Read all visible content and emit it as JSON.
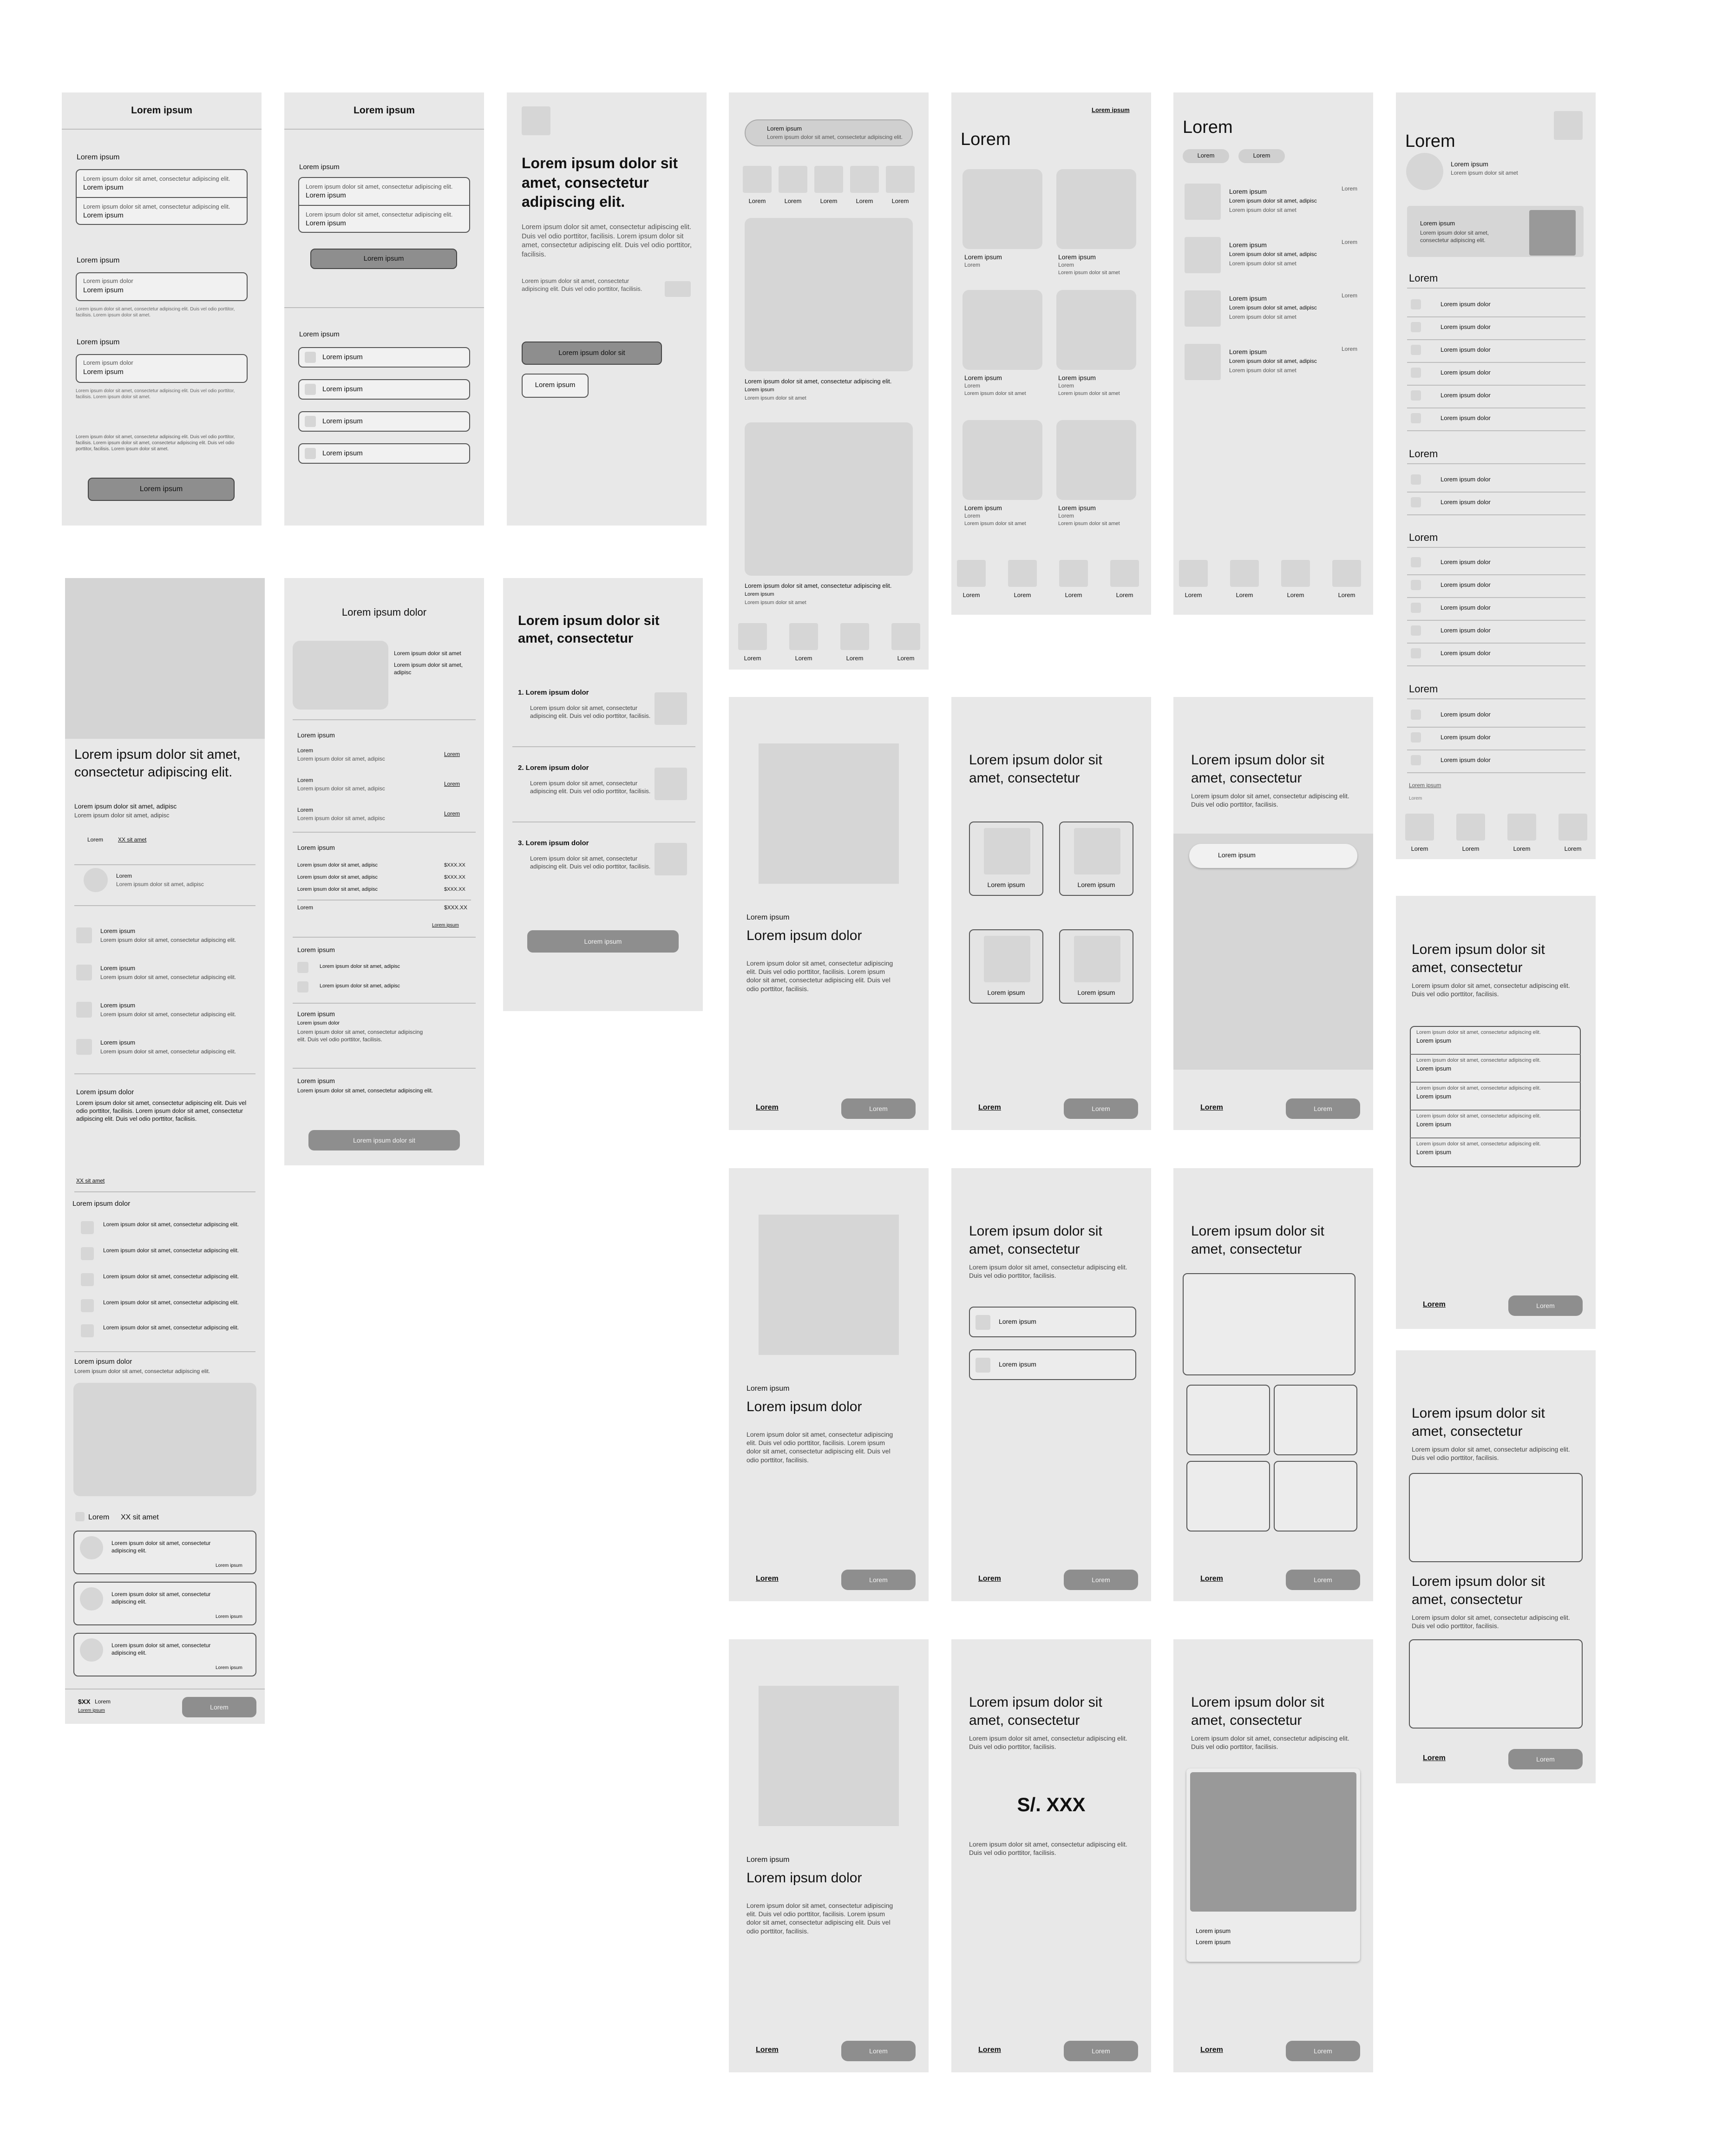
{
  "L": {
    "lorem": "Lorem",
    "lorem_ipsum": "Lorem ipsum",
    "lorem_ipsum_dolor": "Lorem ipsum dolor",
    "lorem_ipsum_dolor_sit": "Lorem ipsum dolor sit",
    "heading2": "Lorem ipsum dolor sit amet, consectetur",
    "heading3": "Lorem ipsum dolor sit amet, consectetur adipiscing elit.",
    "field_hint": "Lorem ipsum dolor sit amet, consectetur adipiscing elit.",
    "body2": "Lorem ipsum dolor sit amet, consectetur adipiscing elit. Duis vel odio porttitor, facilisis.",
    "body_long": "Lorem ipsum dolor sit amet, consectetur adipiscing elit. Duis vel odio porttitor, facilisis. Lorem ipsum dolor sit amet, consectetur adipiscing elit. Duis vel odio porttitor, facilisis.",
    "small_text": "Lorem ipsum dolor sit amet, consectetur adipiscing elit. Duis vel odio porttitor, facilisis. Lorem ipsum dolor sit amet.",
    "sit_amet": "Lorem ipsum dolor sit amet",
    "sit_amet_adipisc": "Lorem ipsum dolor sit amet, adipisc",
    "consectetur_adipiscing": "Lorem ipsum dolor sit amet, consectetur adipiscing elit.",
    "xx_sit_amet": "XX sit amet",
    "price_tag": "$XX",
    "price_cell": "$XXX.XX",
    "currency": "S/. XXX",
    "list1": "1. Lorem ipsum dolor",
    "list2": "2. Lorem ipsum dolor",
    "list3": "3. Lorem ipsum dolor",
    "legal": "Lorem ipsum dolor sit amet, consectetur adipiscing elit. Duis vel odio porttitor, facilisis. Lorem ipsum dolor sit amet, consectetur adipiscing elit. Duis vel odio porttitor, facilisis. Lorem ipsum dolor sit amet.",
    "link_text": "Lorem ipsum"
  }
}
